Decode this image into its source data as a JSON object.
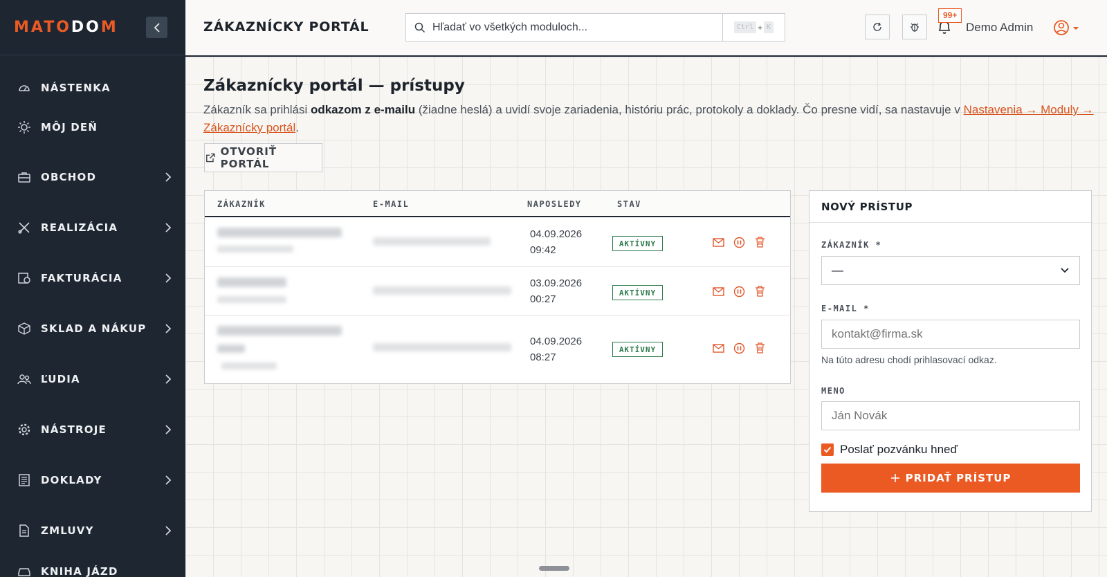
{
  "brand": {
    "logo_orange_1": "MATO",
    "logo_white": "DO",
    "logo_orange_2": "M"
  },
  "colors": {
    "accent": "#ec5a24",
    "sidebar": "#1d2631",
    "status_active": "#2d7a4a"
  },
  "sidebar": {
    "items": [
      {
        "label": "NÁSTENKA",
        "icon": "dashboard-icon",
        "has_submenu": false
      },
      {
        "label": "MÔJ DEŇ",
        "icon": "sun-icon",
        "has_submenu": false
      },
      {
        "label": "OBCHOD",
        "icon": "briefcase-icon",
        "has_submenu": true
      },
      {
        "label": "REALIZÁCIA",
        "icon": "tools-icon",
        "has_submenu": true
      },
      {
        "label": "FAKTURÁCIA",
        "icon": "invoice-icon",
        "has_submenu": true
      },
      {
        "label": "SKLAD A NÁKUP",
        "icon": "box-icon",
        "has_submenu": true
      },
      {
        "label": "ĽUDIA",
        "icon": "people-icon",
        "has_submenu": true
      },
      {
        "label": "NÁSTROJE",
        "icon": "gear-icon",
        "has_submenu": true
      },
      {
        "label": "DOKLADY",
        "icon": "document-icon",
        "has_submenu": true
      },
      {
        "label": "ZMLUVY",
        "icon": "contract-icon",
        "has_submenu": true
      },
      {
        "label": "KNIHA JÁZD",
        "icon": "car-icon",
        "has_submenu": false
      }
    ]
  },
  "header": {
    "title": "ZÁKAZNÍCKY PORTÁL",
    "search_placeholder": "Hľadať vo všetkých moduloch...",
    "shortcut_key_1": "Ctrl",
    "shortcut_plus": "+",
    "shortcut_key_2": "K",
    "notification_count": "99+",
    "user_name": "Demo Admin"
  },
  "page": {
    "title": "Zákaznícky portál — prístupy",
    "desc_part1": "Zákazník sa prihlási ",
    "desc_bold": "odkazom z e-mailu",
    "desc_part2": " (žiadne heslá) a uvidí svoje zariadenia, históriu prác, protokoly a doklady. Čo presne vidí, sa nastavuje v ",
    "desc_link": "Nastavenia → Moduly → Zákaznícky portál",
    "desc_end": ".",
    "open_portal_label": "OTVORIŤ PORTÁL"
  },
  "table": {
    "columns": [
      "ZÁKAZNÍK",
      "E-MAIL",
      "NAPOSLEDY",
      "STAV"
    ],
    "rows": [
      {
        "last_date": "04.09.2026",
        "last_time": "09:42",
        "status": "AKTÍVNY"
      },
      {
        "last_date": "03.09.2026",
        "last_time": "00:27",
        "status": "AKTÍVNY"
      },
      {
        "last_date": "04.09.2026",
        "last_time": "08:27",
        "status": "AKTÍVNY"
      }
    ]
  },
  "form": {
    "title": "NOVÝ PRÍSTUP",
    "customer_label": "ZÁKAZNÍK *",
    "customer_value": "—",
    "email_label": "E-MAIL *",
    "email_placeholder": "kontakt@firma.sk",
    "email_hint": "Na túto adresu chodí prihlasovací odkaz.",
    "name_label": "MENO",
    "name_placeholder": "Ján Novák",
    "invite_label": "Poslať pozvánku hneď",
    "invite_checked": true,
    "submit_label": "PRIDAŤ PRÍSTUP"
  }
}
